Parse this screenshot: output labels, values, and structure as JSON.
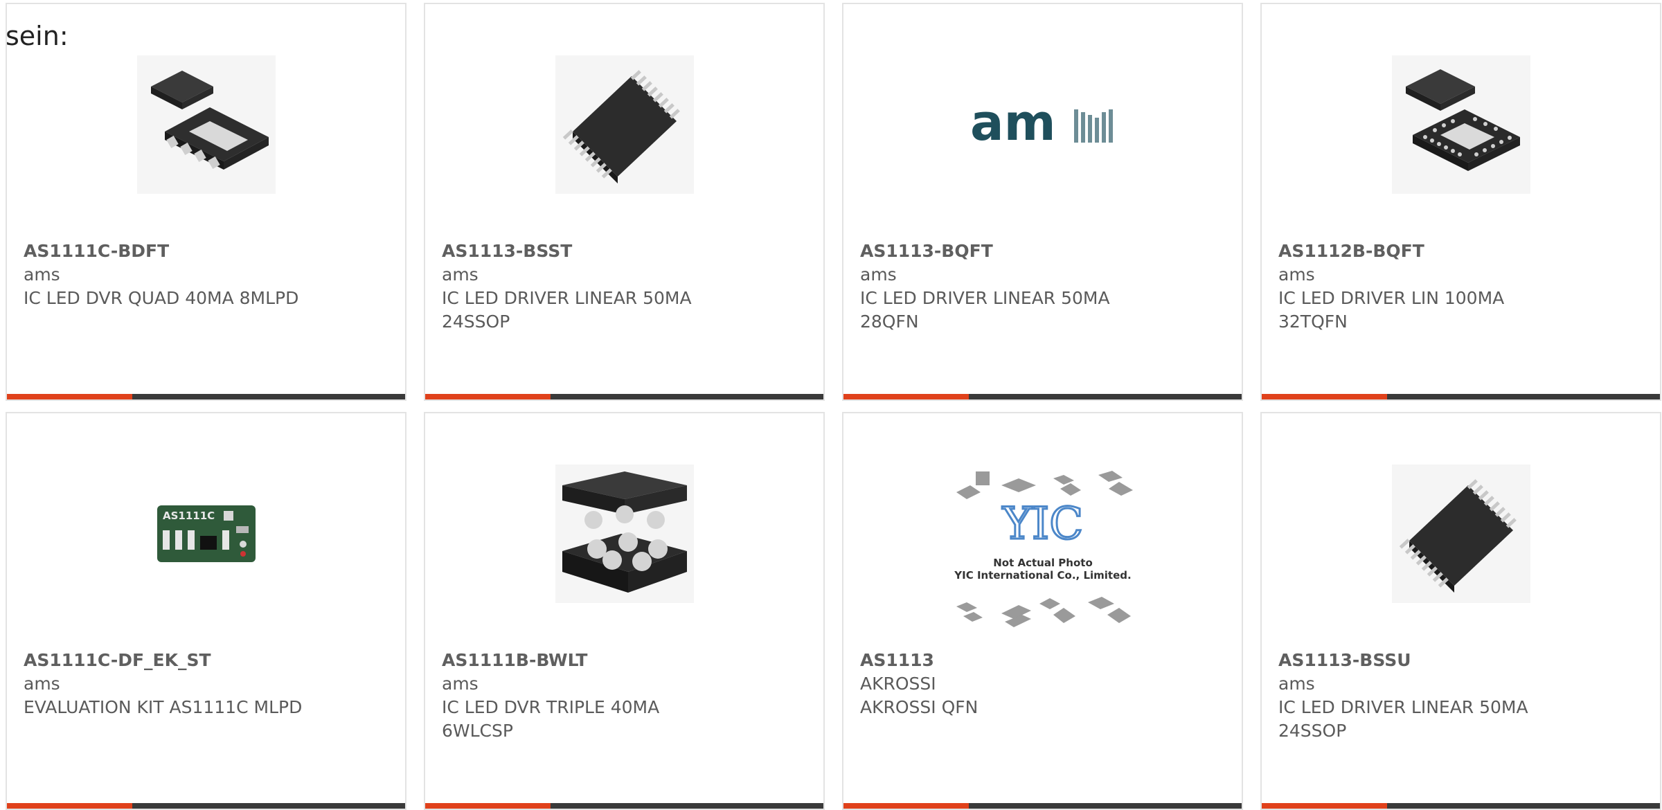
{
  "lead_text": "sein:",
  "accent_color": "#e0411b",
  "bar_color": "#3a3a3a",
  "products": [
    {
      "part": "AS1111C-BDFT",
      "manufacturer": "ams",
      "description": "IC LED DVR QUAD 40MA 8MLPD",
      "image": "dfn-package-icon"
    },
    {
      "part": "AS1113-BSST",
      "manufacturer": "ams",
      "description": "IC LED DRIVER LINEAR 50MA 24SSOP",
      "image": "ssop-package-icon"
    },
    {
      "part": "AS1113-BQFT",
      "manufacturer": "ams",
      "description": "IC LED DRIVER LINEAR 50MA 28QFN",
      "image": "ams-logo",
      "logo_text": "am"
    },
    {
      "part": "AS1112B-BQFT",
      "manufacturer": "ams",
      "description": "IC LED DRIVER LIN 100MA 32TQFN",
      "image": "qfn-package-icon"
    },
    {
      "part": "AS1111C-DF_EK_ST",
      "manufacturer": "ams",
      "description": "EVALUATION KIT AS1111C MLPD",
      "image": "eval-board-icon",
      "board_text": "AS1111C"
    },
    {
      "part": "AS1111B-BWLT",
      "manufacturer": "ams",
      "description": "IC LED DVR TRIPLE 40MA 6WLCSP",
      "image": "wlcsp-package-icon"
    },
    {
      "part": "AS1113",
      "manufacturer": "AKROSSI",
      "description": "AKROSSI QFN",
      "image": "yic-placeholder-icon",
      "placeholder_lines": [
        "Not Actual Photo",
        "YIC International Co., Limited."
      ],
      "placeholder_logo": "YIC"
    },
    {
      "part": "AS1113-BSSU",
      "manufacturer": "ams",
      "description": "IC LED DRIVER LINEAR 50MA 24SSOP",
      "image": "ssop-package-icon"
    }
  ]
}
